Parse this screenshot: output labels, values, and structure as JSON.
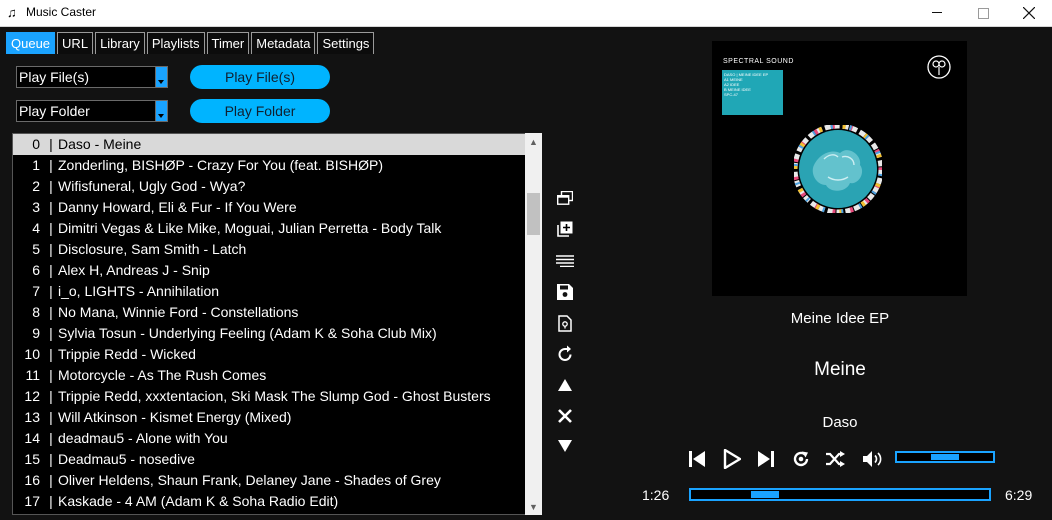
{
  "window": {
    "title": "Music Caster"
  },
  "tabs": [
    "Queue",
    "URL",
    "Library",
    "Playlists",
    "Timer",
    "Metadata",
    "Settings"
  ],
  "active_tab": "Queue",
  "controls": {
    "combo_file": "Play File(s)",
    "button_file": "Play File(s)",
    "combo_folder": "Play Folder",
    "button_folder": "Play Folder"
  },
  "queue": [
    {
      "num": "0",
      "title": "Daso - Meine"
    },
    {
      "num": "1",
      "title": "Zonderling, BISHØP - Crazy For You (feat. BISHØP)"
    },
    {
      "num": "2",
      "title": "Wifisfuneral, Ugly God - Wya?"
    },
    {
      "num": "3",
      "title": "Danny Howard, Eli & Fur - If You Were"
    },
    {
      "num": "4",
      "title": "Dimitri Vegas & Like Mike, Moguai, Julian Perretta - Body Talk"
    },
    {
      "num": "5",
      "title": "Disclosure, Sam Smith - Latch"
    },
    {
      "num": "6",
      "title": "Alex H, Andreas J - Snip"
    },
    {
      "num": "7",
      "title": "i_o, LIGHTS - Annihilation"
    },
    {
      "num": "8",
      "title": "No Mana, Winnie Ford - Constellations"
    },
    {
      "num": "9",
      "title": "Sylvia Tosun - Underlying Feeling (Adam K & Soha Club Mix)"
    },
    {
      "num": "10",
      "title": "Trippie Redd - Wicked"
    },
    {
      "num": "11",
      "title": "Motorcycle - As The Rush Comes"
    },
    {
      "num": "12",
      "title": "Trippie Redd, xxxtentacion, Ski Mask The Slump God - Ghost Busters"
    },
    {
      "num": "13",
      "title": "Will Atkinson - Kismet Energy (Mixed)"
    },
    {
      "num": "14",
      "title": "deadmau5 - Alone with You"
    },
    {
      "num": "15",
      "title": "Deadmau5 - nosedive"
    },
    {
      "num": "16",
      "title": "Oliver Heldens, Shaun Frank, Delaney Jane - Shades of Grey"
    },
    {
      "num": "17",
      "title": "Kaskade - 4 AM (Adam K & Soha Radio Edit)"
    }
  ],
  "separator": "|",
  "selected_index": 0,
  "side_buttons": [
    "window-restore-icon",
    "add-to-queue-icon",
    "list-lines-icon",
    "save-icon",
    "file-location-icon",
    "repeat-arrow-icon",
    "move-up-icon",
    "remove-icon",
    "move-down-icon"
  ],
  "now_playing": {
    "album": "Meine Idee EP",
    "title": "Meine",
    "artist": "Daso",
    "time_elapsed": "1:26",
    "time_total": "6:29",
    "progress_fraction": 0.221,
    "volume_fraction": 0.5
  },
  "album_art": {
    "label": "SPECTRAL SOUND",
    "cover_lines": [
      "DASO | MEINE IDEE EP",
      "A1 MEINE",
      "A2 IDEE",
      "B MEINE IDEE",
      "SPC-47"
    ]
  },
  "colors": {
    "accent": "#1aa3ff",
    "pill": "#00b4ff",
    "background": "#121212",
    "selected_row": "#d9d9d9"
  }
}
